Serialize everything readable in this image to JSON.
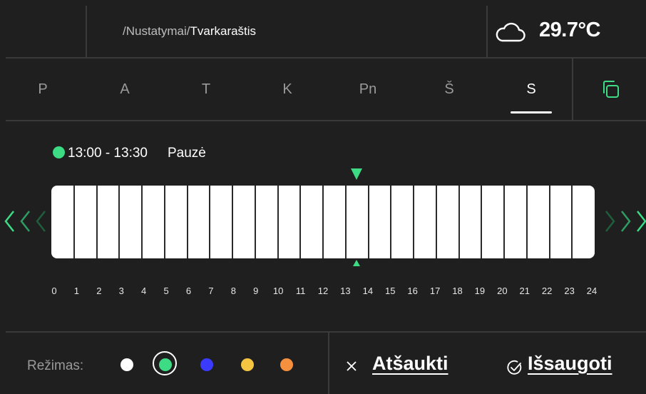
{
  "header": {
    "breadcrumb_parent": "/Nustatymai/",
    "breadcrumb_current": "Tvarkaraštis",
    "weather_icon": "cloud-icon",
    "temperature": "29.7°C"
  },
  "days": {
    "items": [
      "P",
      "A",
      "T",
      "K",
      "Pn",
      "Š",
      "S"
    ],
    "active_index": 6,
    "copy_icon": "copy-icon"
  },
  "schedule": {
    "selected_range": "13:00 - 13:30",
    "selected_label": "Pauzė",
    "marker_hour": 13.5,
    "hours": [
      "0",
      "1",
      "2",
      "3",
      "4",
      "5",
      "6",
      "7",
      "8",
      "9",
      "10",
      "11",
      "12",
      "13",
      "14",
      "15",
      "16",
      "17",
      "18",
      "19",
      "20",
      "21",
      "22",
      "23",
      "24"
    ]
  },
  "footer": {
    "mode_label": "Režimas:",
    "modes": [
      "#ffffff",
      "#3ddc84",
      "#3b3bff",
      "#f5c542",
      "#f5913e"
    ],
    "selected_mode_index": 1,
    "cancel_label": "Atšaukti",
    "save_label": "Išsaugoti"
  },
  "colors": {
    "accent": "#3ddc84",
    "background": "#1f1f1f",
    "divider": "#3a3a3a"
  }
}
